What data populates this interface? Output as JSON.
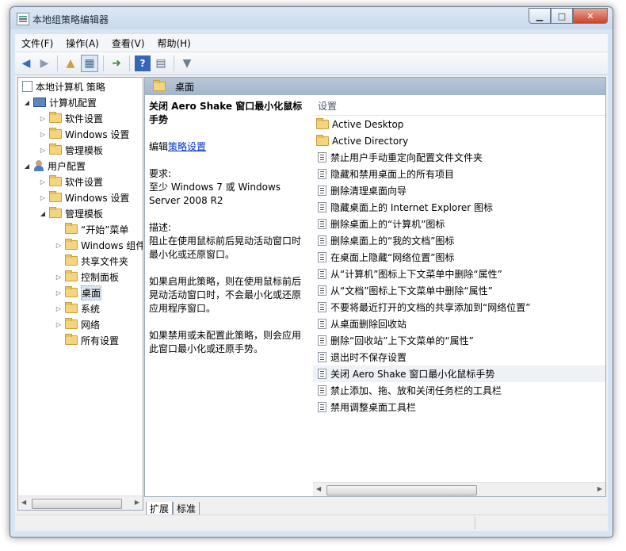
{
  "window": {
    "title": "本地组策略编辑器",
    "min": "▁",
    "max": "□",
    "close": "✕"
  },
  "menu": [
    "文件(F)",
    "操作(A)",
    "查看(V)",
    "帮助(H)"
  ],
  "toolbar_icons": [
    "back-icon",
    "forward-icon",
    "up-folder-icon",
    "show-hide-tree-icon",
    "export-icon",
    "help-icon",
    "properties-icon",
    "filter-icon"
  ],
  "tree": {
    "root": "本地计算机 策略",
    "computer": "计算机配置",
    "computer_children": [
      "软件设置",
      "Windows 设置",
      "管理模板"
    ],
    "user": "用户配置",
    "user_children": [
      "软件设置",
      "Windows 设置",
      "管理模板"
    ],
    "admin_children": [
      "“开始”菜单",
      "Windows 组件",
      "共享文件夹",
      "控制面板",
      "桌面",
      "系统",
      "网络",
      "所有设置"
    ]
  },
  "pane": {
    "header": "桌面",
    "policy_title": "关闭 Aero Shake 窗口最小化鼠标手势",
    "edit_prefix": "编辑",
    "edit_link": "策略设置",
    "req_label": "要求:",
    "req_text": "至少 Windows 7 或 Windows Server 2008 R2",
    "desc_label": "描述:",
    "desc_text": "阻止在使用鼠标前后晃动活动窗口时最小化或还原窗口。",
    "enabled_text": "如果启用此策略，则在使用鼠标前后晃动活动窗口时，不会最小化或还原应用程序窗口。",
    "disabled_text": "如果禁用或未配置此策略，则会应用此窗口最小化或还原手势。",
    "list_header": "设置",
    "folders": [
      "Active Desktop",
      "Active Directory"
    ],
    "settings": [
      "禁止用户手动重定向配置文件文件夹",
      "隐藏和禁用桌面上的所有项目",
      "删除清理桌面向导",
      "隐藏桌面上的 Internet Explorer 图标",
      "删除桌面上的“计算机”图标",
      "删除桌面上的“我的文档”图标",
      "在桌面上隐藏“网络位置”图标",
      "从“计算机”图标上下文菜单中删除“属性”",
      "从“文档”图标上下文菜单中删除“属性”",
      "不要将最近打开的文档的共享添加到“网络位置”",
      "从桌面删除回收站",
      "删除“回收站”上下文菜单的“属性”",
      "退出时不保存设置",
      "关闭 Aero Shake 窗口最小化鼠标手势",
      "禁止添加、拖、放和关闭任务栏的工具栏",
      "禁用调整桌面工具栏"
    ],
    "selected_setting": "关闭 Aero Shake 窗口最小化鼠标手势"
  },
  "tabs": [
    "扩展",
    "标准"
  ]
}
